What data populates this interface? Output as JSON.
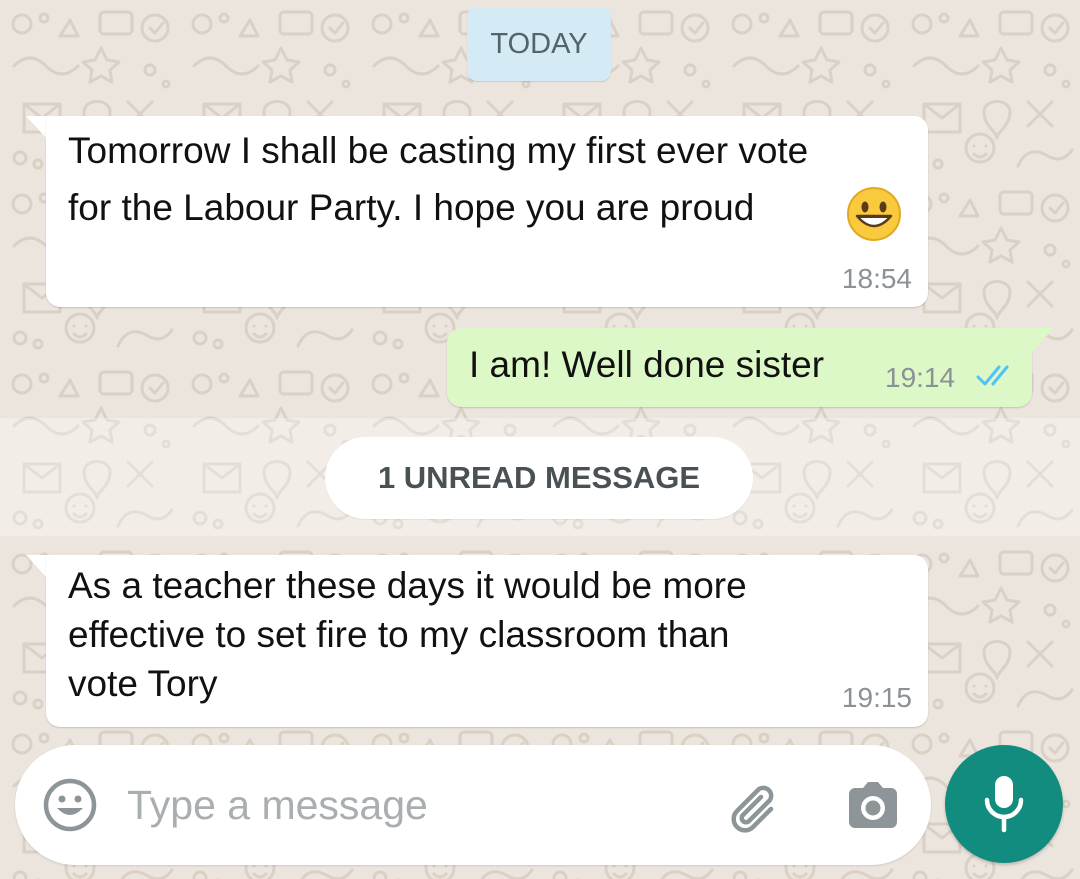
{
  "chat": {
    "date_label": "TODAY",
    "unread_label": "1 UNREAD MESSAGE",
    "messages": [
      {
        "direction": "incoming",
        "text": "Tomorrow I shall be casting my first ever vote\nfor the Labour Party. I hope you are proud",
        "emoji": "grinning-face",
        "time": "18:54"
      },
      {
        "direction": "outgoing",
        "text": "I am! Well done sister",
        "time": "19:14",
        "status": "read"
      },
      {
        "direction": "incoming",
        "text": "As a teacher these days it would be more\neffective to set fire to my classroom than\nvote Tory",
        "time": "19:15"
      }
    ]
  },
  "composer": {
    "placeholder": "Type a message",
    "value": "",
    "icons": {
      "emoji": "smiley-icon",
      "attach": "paperclip-icon",
      "camera": "camera-icon",
      "mic": "microphone-icon"
    }
  },
  "colors": {
    "wallpaper": "#ece5dd",
    "incoming_bubble": "#ffffff",
    "outgoing_bubble": "#dcf8c6",
    "date_chip": "#d4eaf4",
    "read_ticks": "#4fc3f7",
    "mic_button": "#128c7e"
  }
}
